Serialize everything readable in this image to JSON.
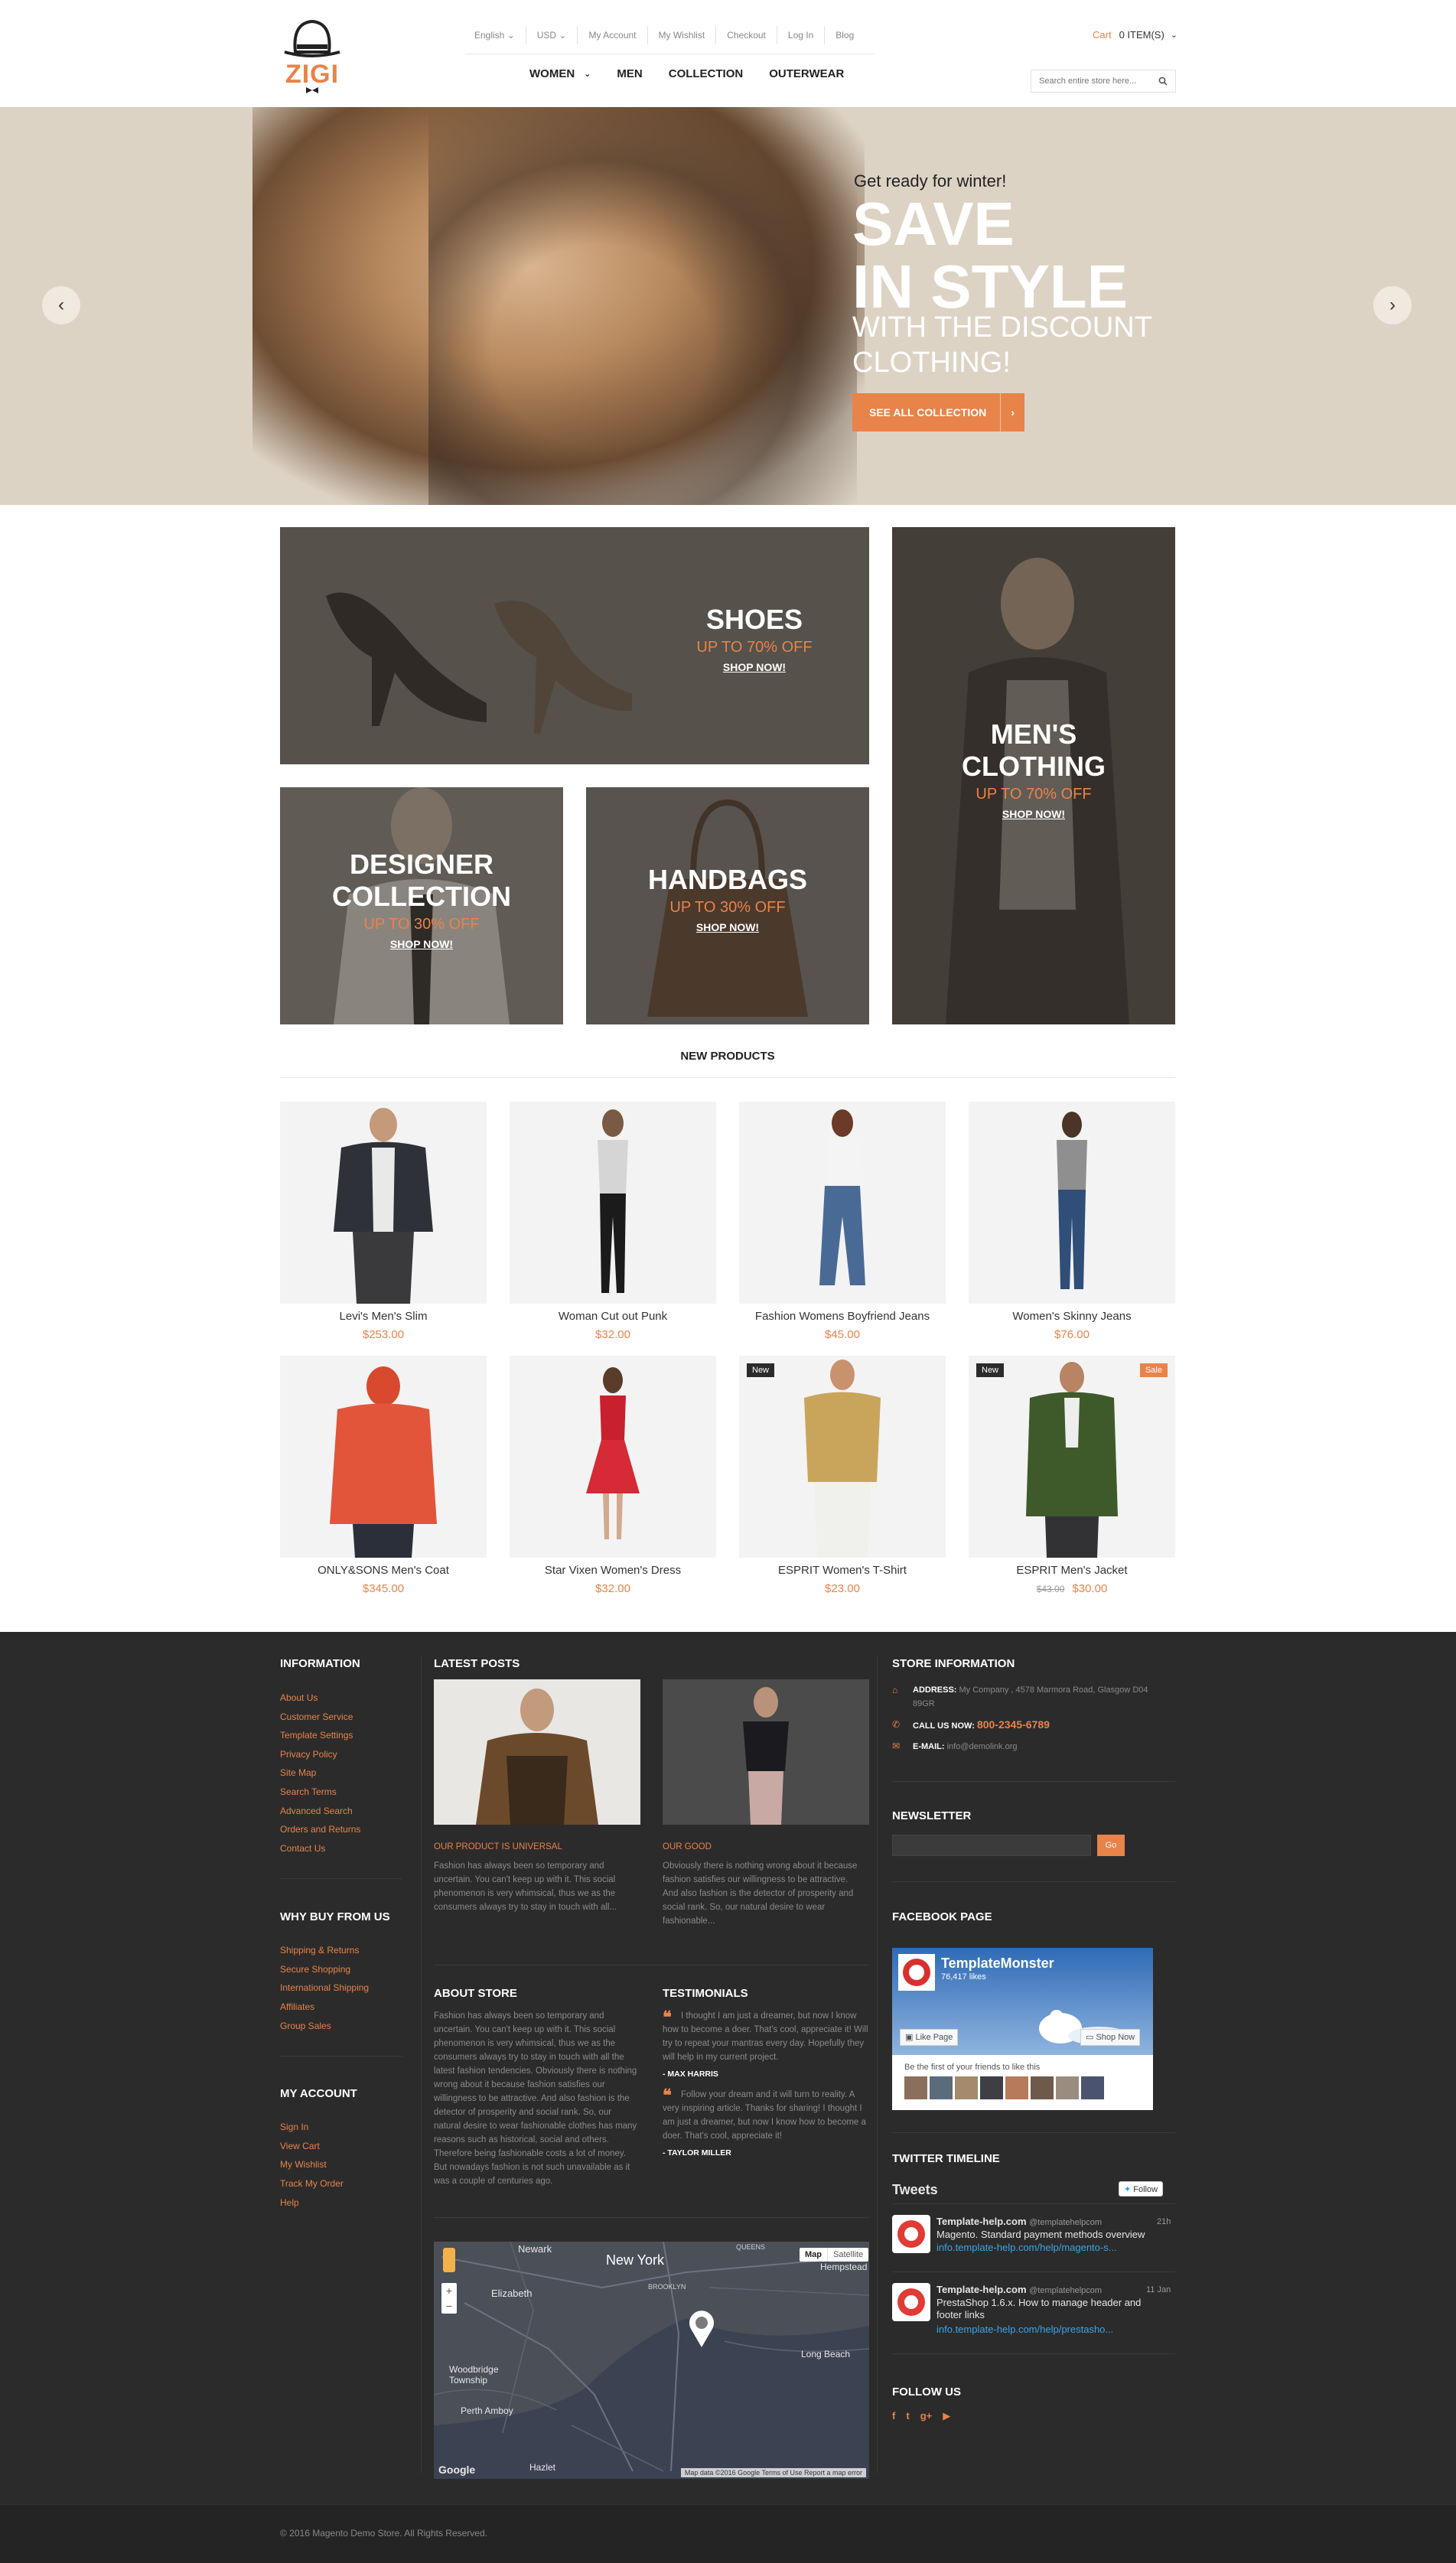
{
  "header": {
    "logo_text": "ZIGI",
    "top_links": [
      "English",
      "USD",
      "My Account",
      "My Wishlist",
      "Checkout",
      "Log In",
      "Blog"
    ],
    "main_nav": [
      "WOMEN",
      "MEN",
      "COLLECTION",
      "OUTERWEAR"
    ],
    "cart_label": "Cart",
    "cart_count": "0 ITEM(S)",
    "search_placeholder": "Search entire store here..."
  },
  "hero": {
    "sub": "Get ready for winter!",
    "title_line1": "SAVE",
    "title_line2": "IN STYLE",
    "subtitle_line1": "WITH THE DISCOUNT",
    "subtitle_line2": "CLOTHING!",
    "button": "SEE ALL COLLECTION",
    "prev_arrow": "‹",
    "next_arrow": "›"
  },
  "banners": {
    "shoes": {
      "title": "SHOES",
      "discount": "UP TO 70% OFF",
      "link": "SHOP NOW!"
    },
    "mens": {
      "title_line1": "MEN'S",
      "title_line2": "CLOTHING",
      "discount": "UP TO 70% OFF",
      "link": "SHOP NOW!"
    },
    "designer": {
      "title_line1": "DESIGNER",
      "title_line2": "COLLECTION",
      "discount": "UP TO 30% OFF",
      "link": "SHOP NOW!"
    },
    "handbags": {
      "title": "HANDBAGS",
      "discount": "UP TO 30% OFF",
      "link": "SHOP NOW!"
    }
  },
  "new_products": {
    "title": "NEW PRODUCTS",
    "items": [
      {
        "name": "Levi's Men's Slim",
        "price": "$253.00"
      },
      {
        "name": "Woman Cut out Punk",
        "price": "$32.00"
      },
      {
        "name": "Fashion Womens Boyfriend Jeans",
        "price": "$45.00"
      },
      {
        "name": "Women's Skinny Jeans",
        "price": "$76.00"
      },
      {
        "name": "ONLY&SONS Men's Coat",
        "price": "$345.00"
      },
      {
        "name": "Star Vixen Women's Dress",
        "price": "$32.00"
      },
      {
        "name": "ESPRIT Women's T-Shirt",
        "price": "$23.00",
        "badge": "New"
      },
      {
        "name": "ESPRIT Men's Jacket",
        "price": "$30.00",
        "old_price": "$43.00",
        "badge": "New",
        "badge2": "Sale"
      }
    ]
  },
  "footer": {
    "information_title": "INFORMATION",
    "information_links": [
      "About Us",
      "Customer Service",
      "Template Settings",
      "Privacy Policy",
      "Site Map",
      "Search Terms",
      "Advanced Search",
      "Orders and Returns",
      "Contact Us"
    ],
    "why_title": "WHY BUY FROM US",
    "why_links": [
      "Shipping & Returns",
      "Secure Shopping",
      "International Shipping",
      "Affiliates",
      "Group Sales"
    ],
    "account_title": "MY ACCOUNT",
    "account_links": [
      "Sign In",
      "View Cart",
      "My Wishlist",
      "Track My Order",
      "Help"
    ],
    "latest_posts_title": "LATEST POSTS",
    "post1_title": "OUR PRODUCT IS UNIVERSAL",
    "post1_text": "Fashion has always been so temporary and uncertain. You can't keep up with it. This social phenomenon is very whimsical, thus we as the consumers always try to stay in touch with all...",
    "post2_title": "OUR GOOD",
    "post2_text": "Obviously there is nothing wrong about it because fashion satisfies our willingness to be attractive. And also fashion is the detector of prosperity and social rank. So, our natural desire to wear fashionable...",
    "about_title": "ABOUT STORE",
    "about_text": "Fashion has always been so temporary and uncertain. You can't keep up with it. This social phenomenon is very whimsical, thus we as the consumers always try to stay in touch with all the latest fashion tendencies. Obviously there is nothing wrong about it because fashion satisfies our willingness to be attractive. And also fashion is the detector of prosperity and social rank. So, our natural desire to wear fashionable clothes has many reasons such as historical, social and others. Therefore being fashionable costs a lot of money. But nowadays fashion is not such unavailable as it was a couple of centuries ago.",
    "testimonials_title": "TESTIMONIALS",
    "testimonial1": "I thought I am just a dreamer, but now I know how to become a doer. That's cool, appreciate it! Will try to repeat your mantras every day. Hopefully they will help in my current project.",
    "testimonial1_author": "- MAX HARRIS",
    "testimonial2": "Follow your dream and it will turn to reality. A very inspiring article. Thanks for sharing! I thought I am just a dreamer, but now I know how to become a doer. That's cool, appreciate it!",
    "testimonial2_author": "- TAYLOR MILLER",
    "map_labels": [
      "Newark",
      "New York",
      "Elizabeth",
      "Woodbridge Township",
      "Perth Amboy",
      "Long Beach",
      "Hempstead",
      "Hazlet",
      "BROOKLYN",
      "QUEENS"
    ],
    "map_btn_map": "Map",
    "map_btn_satellite": "Satellite",
    "map_footer": "Map data ©2016 Google   Terms of Use   Report a map error",
    "map_logo": "Google",
    "store_info_title": "STORE INFORMATION",
    "address_label": "ADDRESS:",
    "address": "My Company , 4578 Marmora Road, Glasgow D04 89GR",
    "call_label": "CALL US NOW:",
    "phone": "800-2345-6789",
    "email_label": "E-MAIL:",
    "email": "info@demolink.org",
    "newsletter_title": "NEWSLETTER",
    "newsletter_button": "Go",
    "facebook_title": "FACEBOOK PAGE",
    "fb_page_name": "TemplateMonster",
    "fb_likes": "76,417 likes",
    "fb_like_btn": "Like Page",
    "fb_shop_btn": "Shop Now",
    "fb_friends": "Be the first of your friends to like this",
    "twitter_title": "TWITTER TIMELINE",
    "tweets_label": "Tweets",
    "follow_btn": "Follow",
    "tweets": [
      {
        "name": "Template-help.com",
        "handle": "@templatehelpcom",
        "time": "21h",
        "text": "Magento. Standard payment methods overview",
        "link": "info.template-help.com/help/magento-s..."
      },
      {
        "name": "Template-help.com",
        "handle": "@templatehelpcom",
        "time": "11 Jan",
        "text": "PrestaShop 1.6.x. How to manage header and footer links",
        "link": "info.template-help.com/help/prestasho..."
      }
    ],
    "follow_title": "FOLLOW US",
    "copyright": "© 2016 Magento Demo Store. All Rights Reserved."
  },
  "colors": {
    "accent": "#e8834a",
    "footer_bg": "#2b2b2b"
  }
}
